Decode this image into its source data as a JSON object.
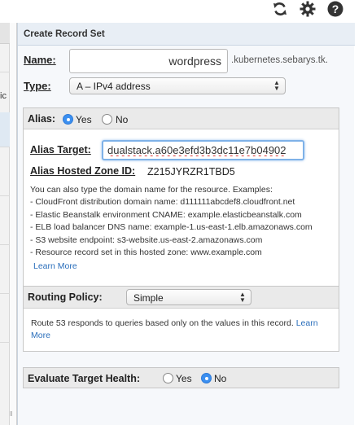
{
  "toolbar": {
    "icons": [
      "refresh-icon",
      "gear-icon",
      "help-icon"
    ]
  },
  "left_pane": {
    "fragment": "ic"
  },
  "panel": {
    "title": "Create Record Set",
    "name_label": "Name:",
    "name_value": "wordpress",
    "domain_suffix": ".kubernetes.sebarys.tk.",
    "type_label": "Type:",
    "type_value": "A – IPv4 address"
  },
  "alias": {
    "label": "Alias:",
    "yes_label": "Yes",
    "no_label": "No",
    "selected": "Yes",
    "target_label": "Alias Target:",
    "target_value": "dualstack.a60e3efd3b3dc11e7b04902",
    "hosted_zone_label": "Alias Hosted Zone ID:",
    "hosted_zone_value": "Z215JYRZR1TBD5",
    "help_intro": "You can also type the domain name for the resource. Examples:",
    "help_items": [
      "- CloudFront distribution domain name: d111111abcdef8.cloudfront.net",
      "- Elastic Beanstalk environment CNAME: example.elasticbeanstalk.com",
      "- ELB load balancer DNS name: example-1.us-east-1.elb.amazonaws.com",
      "- S3 website endpoint: s3-website.us-east-2.amazonaws.com",
      "- Resource record set in this hosted zone: www.example.com"
    ],
    "learn_more": "Learn More"
  },
  "routing": {
    "label": "Routing Policy:",
    "value": "Simple",
    "help": "Route 53 responds to queries based only on the values in this record.",
    "learn_more": "Learn More"
  },
  "evaluate": {
    "label": "Evaluate Target Health:",
    "yes_label": "Yes",
    "no_label": "No",
    "selected": "No"
  },
  "colors": {
    "accent": "#3b8ff0",
    "link": "#2a6ebb",
    "header_bg": "#e8eef5"
  }
}
